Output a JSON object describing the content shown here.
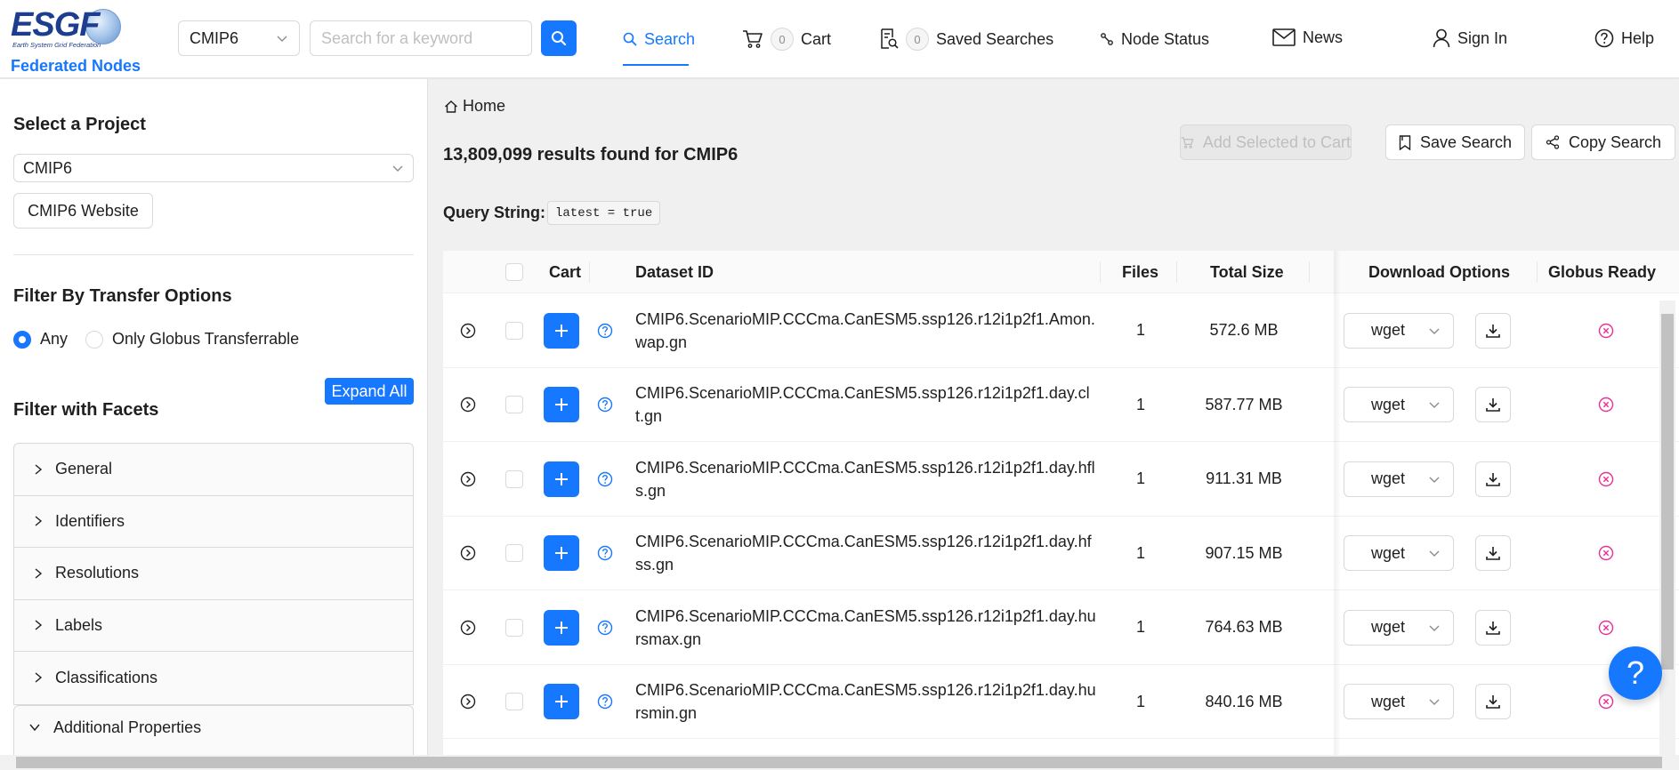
{
  "logo": {
    "mark": "ESGF",
    "tagline": "Earth System Grid Federation",
    "subtitle": "Federated Nodes"
  },
  "header": {
    "project_select": "CMIP6",
    "search_placeholder": "Search for a keyword",
    "nav": {
      "search": "Search",
      "cart": "Cart",
      "cart_count": "0",
      "saved": "Saved Searches",
      "saved_count": "0",
      "node_status": "Node Status",
      "news": "News",
      "sign_in": "Sign In",
      "help": "Help"
    }
  },
  "sidebar": {
    "select_project_title": "Select a Project",
    "project_value": "CMIP6",
    "project_website_btn": "CMIP6 Website",
    "transfer_title": "Filter By Transfer Options",
    "transfer_options": [
      "Any",
      "Only Globus Transferrable"
    ],
    "transfer_selected": "Any",
    "facets_title": "Filter with Facets",
    "expand_all": "Expand All",
    "facet_groups": [
      "General",
      "Identifiers",
      "Resolutions",
      "Labels",
      "Classifications"
    ],
    "additional": "Additional Properties"
  },
  "main": {
    "breadcrumb": "Home",
    "results_title": "13,809,099 results found for CMIP6",
    "query_label": "Query String:",
    "query_value": "latest = true",
    "add_selected": "Add Selected to Cart",
    "save_search": "Save Search",
    "copy_search": "Copy Search"
  },
  "table": {
    "headers": {
      "cart": "Cart",
      "dataset_id": "Dataset ID",
      "files": "Files",
      "total_size": "Total Size",
      "download_options": "Download Options",
      "globus_ready": "Globus Ready"
    },
    "rows": [
      {
        "id": "CMIP6.ScenarioMIP.CCCma.CanESM5.ssp126.r12i1p2f1.Amon.wap.gn",
        "files": "1",
        "size": "572.6 MB",
        "download": "wget"
      },
      {
        "id": "CMIP6.ScenarioMIP.CCCma.CanESM5.ssp126.r12i1p2f1.day.clt.gn",
        "files": "1",
        "size": "587.77 MB",
        "download": "wget"
      },
      {
        "id": "CMIP6.ScenarioMIP.CCCma.CanESM5.ssp126.r12i1p2f1.day.hfls.gn",
        "files": "1",
        "size": "911.31 MB",
        "download": "wget"
      },
      {
        "id": "CMIP6.ScenarioMIP.CCCma.CanESM5.ssp126.r12i1p2f1.day.hfss.gn",
        "files": "1",
        "size": "907.15 MB",
        "download": "wget"
      },
      {
        "id": "CMIP6.ScenarioMIP.CCCma.CanESM5.ssp126.r12i1p2f1.day.hursmax.gn",
        "files": "1",
        "size": "764.63 MB",
        "download": "wget"
      },
      {
        "id": "CMIP6.ScenarioMIP.CCCma.CanESM5.ssp126.r12i1p2f1.day.hursmin.gn",
        "files": "1",
        "size": "840.16 MB",
        "download": "wget"
      }
    ]
  },
  "help_fab": "?",
  "colors": {
    "primary": "#1677ff",
    "globus_x": "#eb2f96",
    "brand": "#1d3d8f"
  }
}
